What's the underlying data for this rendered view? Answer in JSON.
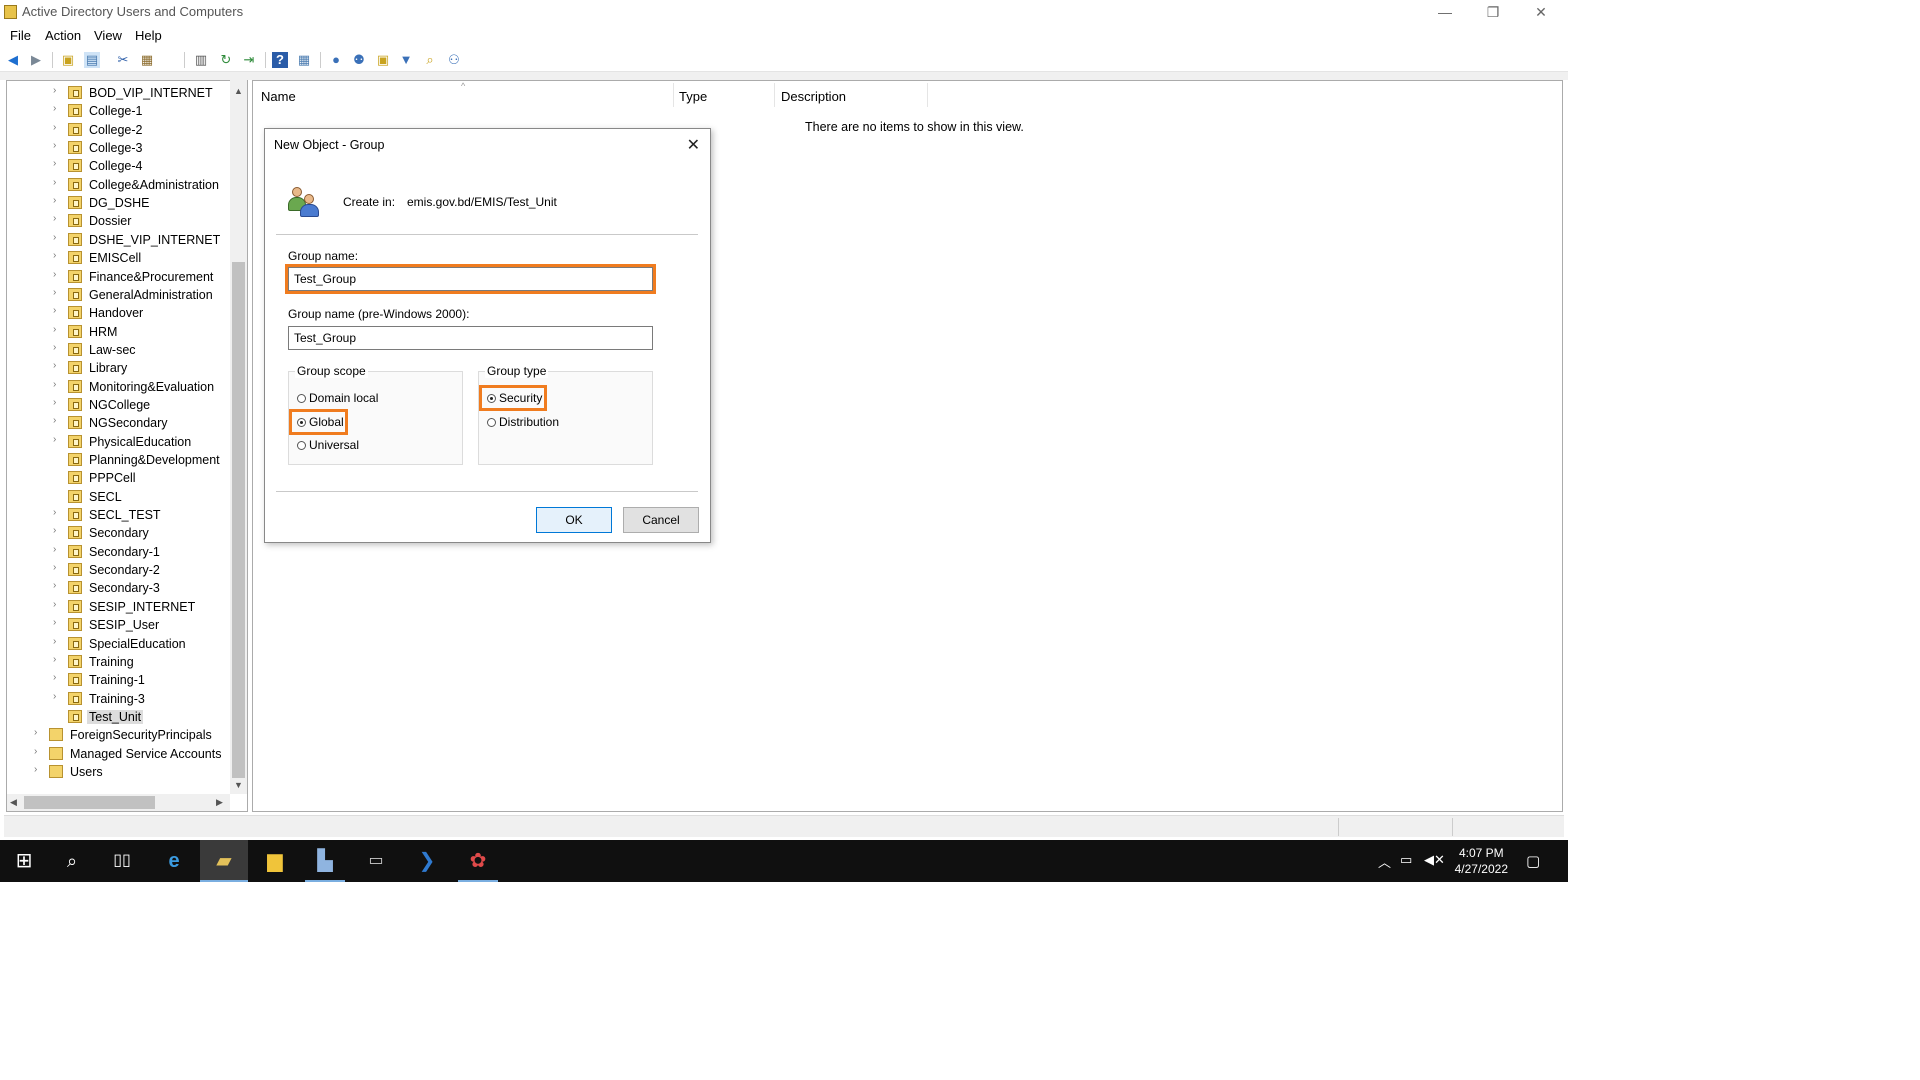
{
  "window": {
    "title": "Active Directory Users and Computers",
    "minimize_glyph": "—",
    "restore_glyph": "❐",
    "close_glyph": "✕"
  },
  "menu": [
    "File",
    "Action",
    "View",
    "Help"
  ],
  "toolbar": {
    "icons": [
      "back-icon",
      "forward-icon",
      "up-folder-icon",
      "show-hide-console-tree-icon",
      "cut-icon",
      "paste-icon",
      "properties-icon",
      "refresh-icon",
      "export-list-icon",
      "help-icon",
      "show-details-icon",
      "new-user-icon",
      "new-group-icon",
      "new-ou-icon",
      "filter-icon",
      "find-icon",
      "add-to-group-icon"
    ]
  },
  "tree": {
    "items": [
      {
        "label": "BOD_VIP_INTERNET",
        "expandable": true,
        "level": 2
      },
      {
        "label": "College-1",
        "expandable": true,
        "level": 2
      },
      {
        "label": "College-2",
        "expandable": true,
        "level": 2
      },
      {
        "label": "College-3",
        "expandable": true,
        "level": 2
      },
      {
        "label": "College-4",
        "expandable": true,
        "level": 2
      },
      {
        "label": "College&Administration",
        "expandable": true,
        "level": 2
      },
      {
        "label": "DG_DSHE",
        "expandable": true,
        "level": 2
      },
      {
        "label": "Dossier",
        "expandable": true,
        "level": 2
      },
      {
        "label": "DSHE_VIP_INTERNET",
        "expandable": true,
        "level": 2
      },
      {
        "label": "EMISCell",
        "expandable": true,
        "level": 2
      },
      {
        "label": "Finance&Procurement",
        "expandable": true,
        "level": 2
      },
      {
        "label": "GeneralAdministration",
        "expandable": true,
        "level": 2
      },
      {
        "label": "Handover",
        "expandable": true,
        "level": 2
      },
      {
        "label": "HRM",
        "expandable": true,
        "level": 2
      },
      {
        "label": "Law-sec",
        "expandable": true,
        "level": 2
      },
      {
        "label": "Library",
        "expandable": true,
        "level": 2
      },
      {
        "label": "Monitoring&Evaluation",
        "expandable": true,
        "level": 2
      },
      {
        "label": "NGCollege",
        "expandable": true,
        "level": 2
      },
      {
        "label": "NGSecondary",
        "expandable": true,
        "level": 2
      },
      {
        "label": "PhysicalEducation",
        "expandable": true,
        "level": 2
      },
      {
        "label": "Planning&Development",
        "expandable": false,
        "level": 2
      },
      {
        "label": "PPPCell",
        "expandable": false,
        "level": 2
      },
      {
        "label": "SECL",
        "expandable": false,
        "level": 2
      },
      {
        "label": "SECL_TEST",
        "expandable": true,
        "level": 2
      },
      {
        "label": "Secondary",
        "expandable": true,
        "level": 2
      },
      {
        "label": "Secondary-1",
        "expandable": true,
        "level": 2
      },
      {
        "label": "Secondary-2",
        "expandable": true,
        "level": 2
      },
      {
        "label": "Secondary-3",
        "expandable": true,
        "level": 2
      },
      {
        "label": "SESIP_INTERNET",
        "expandable": true,
        "level": 2
      },
      {
        "label": "SESIP_User",
        "expandable": true,
        "level": 2
      },
      {
        "label": "SpecialEducation",
        "expandable": true,
        "level": 2
      },
      {
        "label": "Training",
        "expandable": true,
        "level": 2
      },
      {
        "label": "Training-1",
        "expandable": true,
        "level": 2
      },
      {
        "label": "Training-3",
        "expandable": true,
        "level": 2
      },
      {
        "label": "Test_Unit",
        "expandable": false,
        "level": 2,
        "selected": true
      },
      {
        "label": "ForeignSecurityPrincipals",
        "expandable": true,
        "level": 1
      },
      {
        "label": "Managed Service Accounts",
        "expandable": true,
        "level": 1
      },
      {
        "label": "Users",
        "expandable": true,
        "level": 1
      }
    ]
  },
  "list": {
    "columns": [
      "Name",
      "Type",
      "Description"
    ],
    "empty_message": "There are no items to show in this view."
  },
  "dialog": {
    "title": "New Object - Group",
    "create_in_label": "Create in:",
    "create_in_value": "emis.gov.bd/EMIS/Test_Unit",
    "group_name_label": "Group name:",
    "group_name_value": "Test_Group",
    "group_name_pre2000_label": "Group name (pre-Windows 2000):",
    "group_name_pre2000_value": "Test_Group",
    "group_scope": {
      "legend": "Group scope",
      "options": [
        "Domain local",
        "Global",
        "Universal"
      ],
      "selected": "Global"
    },
    "group_type": {
      "legend": "Group type",
      "options": [
        "Security",
        "Distribution"
      ],
      "selected": "Security"
    },
    "ok_label": "OK",
    "cancel_label": "Cancel",
    "highlight_color": "#f07c1f"
  },
  "taskbar": {
    "items": [
      "start-icon",
      "search-icon",
      "task-view-icon",
      "internet-explorer-icon",
      "active-directory-icon",
      "file-explorer-icon",
      "server-manager-icon",
      "command-prompt-icon",
      "powershell-icon",
      "paint-icon"
    ],
    "time": "4:07 PM",
    "date": "4/27/2022"
  }
}
